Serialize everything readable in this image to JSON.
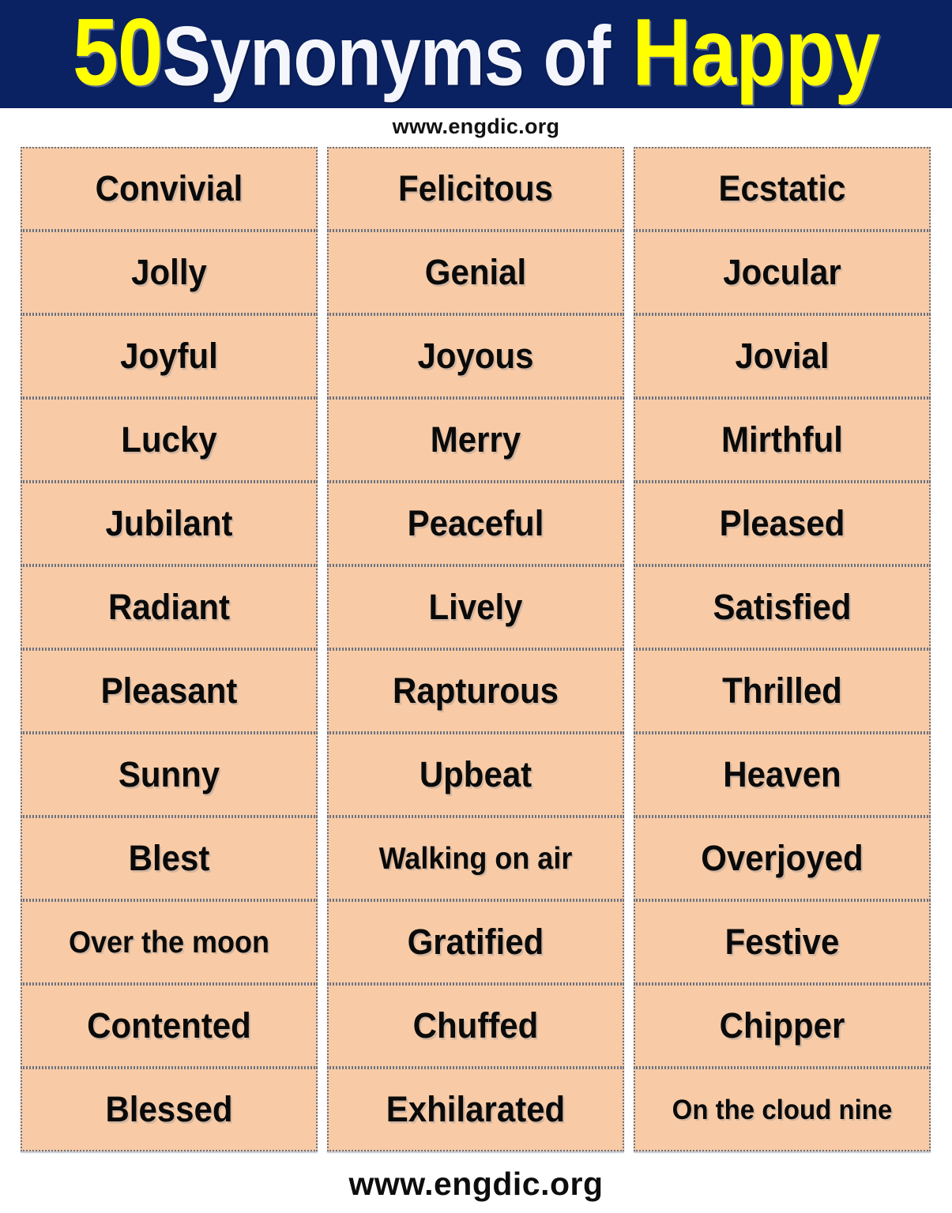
{
  "header": {
    "count": "50",
    "middle": "Synonyms of",
    "word": "Happy",
    "background_color": "#0a2162",
    "count_color": "#ffff00",
    "middle_color": "#ffffff",
    "word_color": "#ffff00"
  },
  "site_url_top": "www.engdic.org",
  "site_url_bottom": "www.engdic.org",
  "grid": {
    "columns": 3,
    "rows": 12,
    "cell_background": "#f8cba6",
    "cell_border_color": "#6b7280",
    "words": [
      "Convivial",
      "Felicitous",
      "Ecstatic",
      "Jolly",
      "Genial",
      "Jocular",
      "Joyful",
      "Joyous",
      "Jovial",
      "Lucky",
      "Merry",
      "Mirthful",
      "Jubilant",
      "Peaceful",
      "Pleased",
      "Radiant",
      "Lively",
      "Satisfied",
      "Pleasant",
      "Rapturous",
      "Thrilled",
      "Sunny",
      "Upbeat",
      "Heaven",
      "Blest",
      "Walking on air",
      "Overjoyed",
      "Over the moon",
      "Gratified",
      "Festive",
      "Contented",
      "Chuffed",
      "Chipper",
      "Blessed",
      "Exhilarated",
      "On the cloud nine"
    ]
  }
}
